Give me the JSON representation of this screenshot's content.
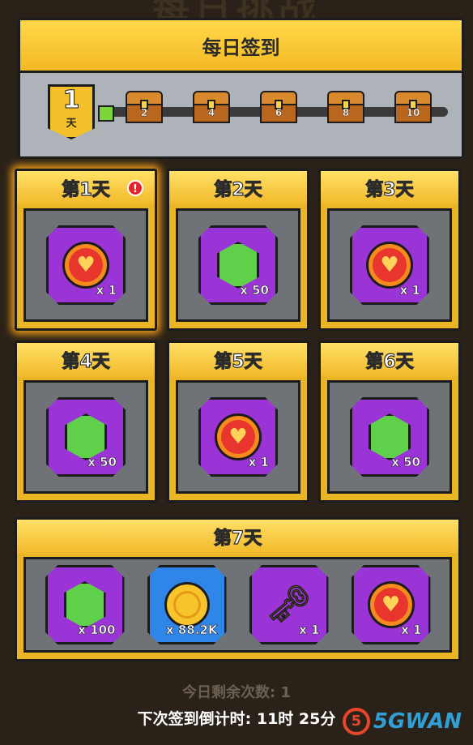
{
  "background_title": "每日挑战",
  "panel": {
    "title": "每日签到",
    "current_day": "1",
    "current_day_unit": "天",
    "milestones": [
      "2",
      "4",
      "6",
      "8",
      "10"
    ]
  },
  "days": [
    {
      "title": "第1天",
      "items": [
        {
          "type": "heart-coin",
          "qty": "x 1"
        }
      ],
      "alert": "!"
    },
    {
      "title": "第2天",
      "items": [
        {
          "type": "gem",
          "qty": "x 50"
        }
      ]
    },
    {
      "title": "第3天",
      "items": [
        {
          "type": "heart-coin",
          "qty": "x 1"
        }
      ]
    },
    {
      "title": "第4天",
      "items": [
        {
          "type": "gem",
          "qty": "x 50"
        }
      ]
    },
    {
      "title": "第5天",
      "items": [
        {
          "type": "heart-coin",
          "qty": "x 1"
        }
      ]
    },
    {
      "title": "第6天",
      "items": [
        {
          "type": "gem",
          "qty": "x 50"
        }
      ]
    },
    {
      "title": "第7天",
      "items": [
        {
          "type": "gem",
          "qty": "x 100"
        },
        {
          "type": "gold-coin",
          "qty": "x 88.2K"
        },
        {
          "type": "key",
          "qty": "x 1"
        },
        {
          "type": "heart-coin",
          "qty": "x 1"
        }
      ]
    }
  ],
  "footer": {
    "remaining": "今日剩余次数: 1",
    "countdown": "下次签到倒计时: 11时 25分"
  },
  "watermark": {
    "logo": "5",
    "text": "5GWAN"
  },
  "colors": {
    "accent": "#f4b923",
    "item_purple": "#9b34d6",
    "item_blue": "#2f86e8",
    "gem": "#5fd04a"
  }
}
